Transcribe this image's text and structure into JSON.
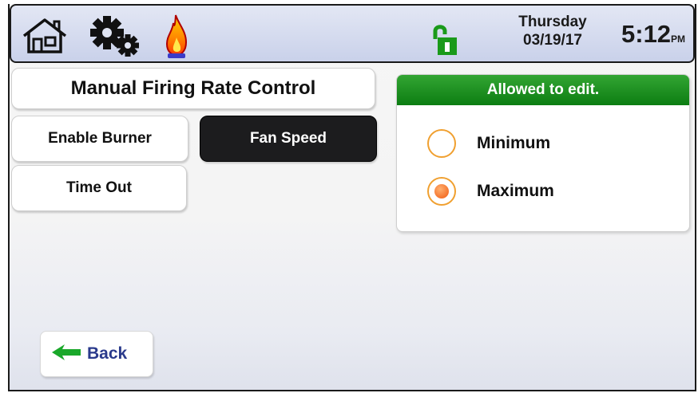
{
  "topbar": {
    "icons": [
      "home-icon",
      "gear-icon",
      "flame-icon",
      "unlock-icon"
    ],
    "day": "Thursday",
    "date": "03/19/17",
    "time": "5:12",
    "ampm": "PM"
  },
  "main": {
    "title": "Manual Firing Rate Control",
    "buttons": {
      "enable_burner": "Enable Burner",
      "fan_speed": "Fan Speed",
      "time_out": "Time Out"
    }
  },
  "edit_panel": {
    "header": "Allowed to edit.",
    "options": [
      {
        "label": "Minimum",
        "selected": false
      },
      {
        "label": "Maximum",
        "selected": true
      }
    ]
  },
  "footer": {
    "back_label": "Back"
  },
  "colors": {
    "accent_green": "#138a18",
    "radio_orange": "#f0a030",
    "selected_dark": "#1c1c1e",
    "back_text": "#2a3a8c"
  }
}
